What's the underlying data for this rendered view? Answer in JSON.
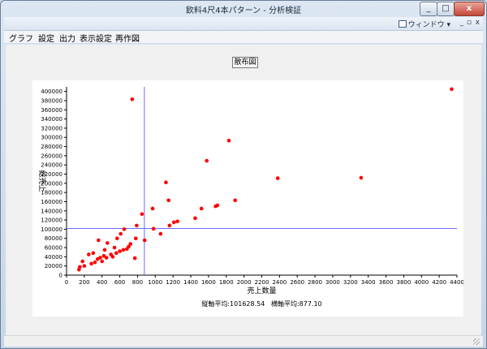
{
  "window": {
    "title": "飲料4尺4本パターン - 分析検証",
    "controls": {
      "minimize": "_",
      "maximize": "□",
      "close": "x"
    }
  },
  "mdi": {
    "window_menu": "ウィンドウ",
    "btn_min": "_",
    "btn_restore": "▫",
    "btn_close": "x"
  },
  "menubar": {
    "items": [
      "グラフ",
      "設定",
      "出力",
      "表示設定",
      "再作図"
    ]
  },
  "chart_button_label": "散布図",
  "averages_text": "縦軸平均:101628.54   横軸平均:877.10",
  "chart_data": {
    "type": "scatter",
    "xlabel": "売上数量",
    "ylabel": "総売上",
    "xlim": [
      0,
      4400
    ],
    "ylim": [
      0,
      410000
    ],
    "x_ticks": [
      0,
      200,
      400,
      600,
      800,
      1000,
      1200,
      1400,
      1600,
      1800,
      2000,
      2200,
      2400,
      2600,
      2800,
      3000,
      3200,
      3400,
      3600,
      3800,
      4000,
      4200,
      4400
    ],
    "y_ticks": [
      0,
      20000,
      40000,
      60000,
      80000,
      100000,
      120000,
      140000,
      160000,
      180000,
      200000,
      220000,
      240000,
      260000,
      280000,
      300000,
      320000,
      340000,
      360000,
      380000,
      400000
    ],
    "mean_x": 877.1,
    "mean_y": 101628.54,
    "grid": false,
    "point_color": "#ff0000",
    "mean_line_color": "#6a6aff",
    "points": [
      [
        140,
        12000
      ],
      [
        150,
        18000
      ],
      [
        180,
        30000
      ],
      [
        200,
        20000
      ],
      [
        250,
        45000
      ],
      [
        280,
        25000
      ],
      [
        300,
        48000
      ],
      [
        320,
        28000
      ],
      [
        350,
        35000
      ],
      [
        360,
        76000
      ],
      [
        380,
        38000
      ],
      [
        400,
        30000
      ],
      [
        420,
        42000
      ],
      [
        430,
        55000
      ],
      [
        450,
        38000
      ],
      [
        460,
        70000
      ],
      [
        500,
        45000
      ],
      [
        520,
        40000
      ],
      [
        540,
        60000
      ],
      [
        560,
        48000
      ],
      [
        570,
        80000
      ],
      [
        600,
        52000
      ],
      [
        610,
        90000
      ],
      [
        640,
        55000
      ],
      [
        650,
        100000
      ],
      [
        680,
        57000
      ],
      [
        700,
        62000
      ],
      [
        720,
        68000
      ],
      [
        740,
        383000
      ],
      [
        770,
        37000
      ],
      [
        780,
        80000
      ],
      [
        790,
        108000
      ],
      [
        850,
        133000
      ],
      [
        880,
        76000
      ],
      [
        970,
        145000
      ],
      [
        980,
        101000
      ],
      [
        1060,
        90000
      ],
      [
        1120,
        202000
      ],
      [
        1150,
        163000
      ],
      [
        1160,
        108000
      ],
      [
        1210,
        115000
      ],
      [
        1250,
        117000
      ],
      [
        1450,
        124000
      ],
      [
        1520,
        145000
      ],
      [
        1580,
        249000
      ],
      [
        1680,
        150000
      ],
      [
        1700,
        152000
      ],
      [
        1830,
        293000
      ],
      [
        1900,
        163000
      ],
      [
        2380,
        211000
      ],
      [
        3320,
        212000
      ],
      [
        4340,
        405000
      ]
    ]
  }
}
